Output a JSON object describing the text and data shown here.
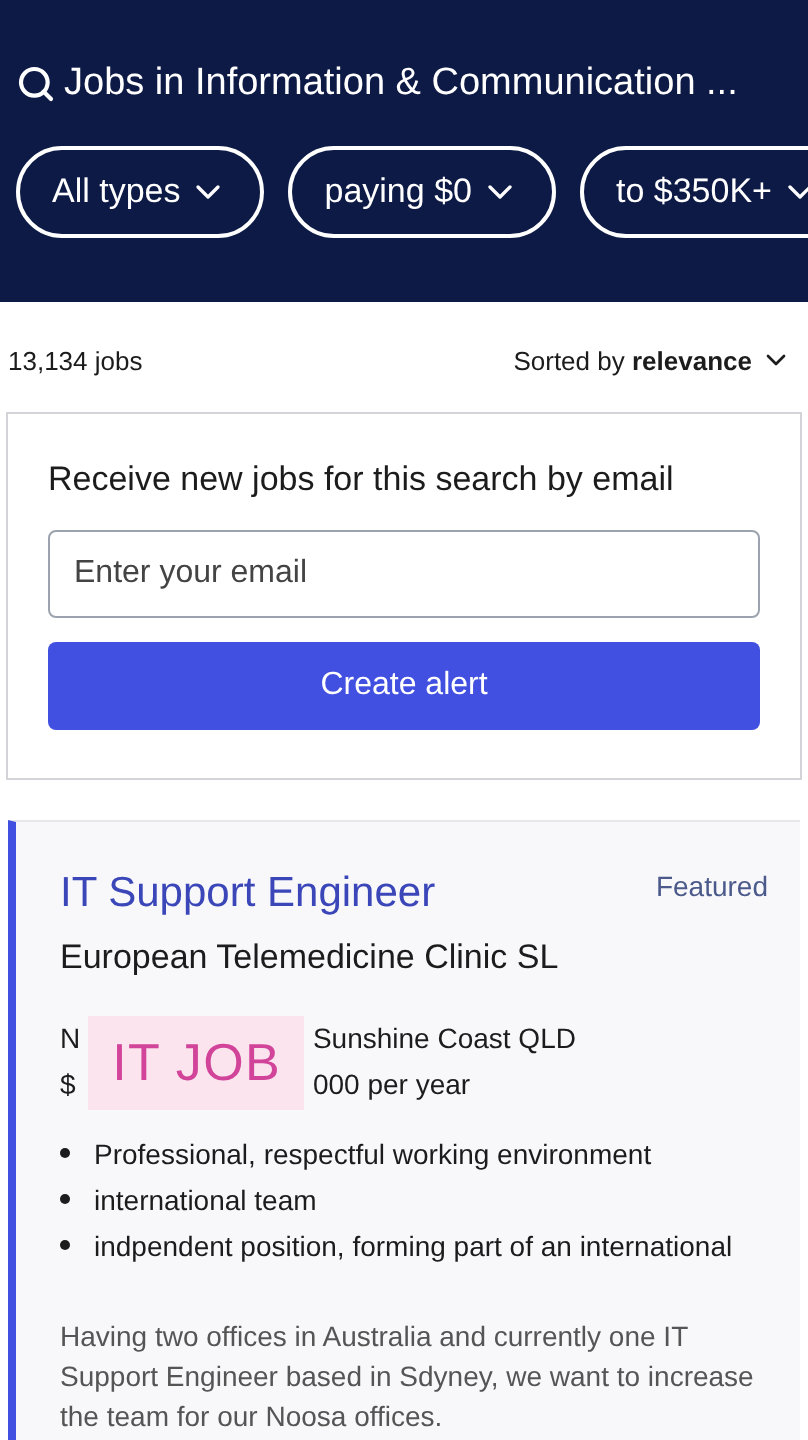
{
  "search": {
    "query": "Jobs in Information & Communication ..."
  },
  "filters": [
    {
      "label": "All types"
    },
    {
      "label": "paying $0"
    },
    {
      "label": "to $350K+"
    }
  ],
  "results": {
    "count": "13,134 jobs",
    "sort_prefix": "Sorted by",
    "sort_value": "relevance"
  },
  "alert": {
    "title": "Receive new jobs for this search by email",
    "placeholder": "Enter your email",
    "button": "Create alert"
  },
  "job": {
    "title": "IT Support Engineer",
    "badge": "Featured",
    "company": "European Telemedicine Clinic SL",
    "sticker": "IT JOB",
    "location": [
      "N",
      "Sunshine Coast QLD"
    ],
    "salary": [
      "$",
      "000 per year"
    ],
    "bullets": [
      "Professional, respectful working environment",
      "international team",
      "indpendent position, forming part of an international"
    ],
    "description": "Having two offices in Australia and currently one IT Support Engineer based in Sdyney, we want to increase the team for our Noosa offices."
  }
}
